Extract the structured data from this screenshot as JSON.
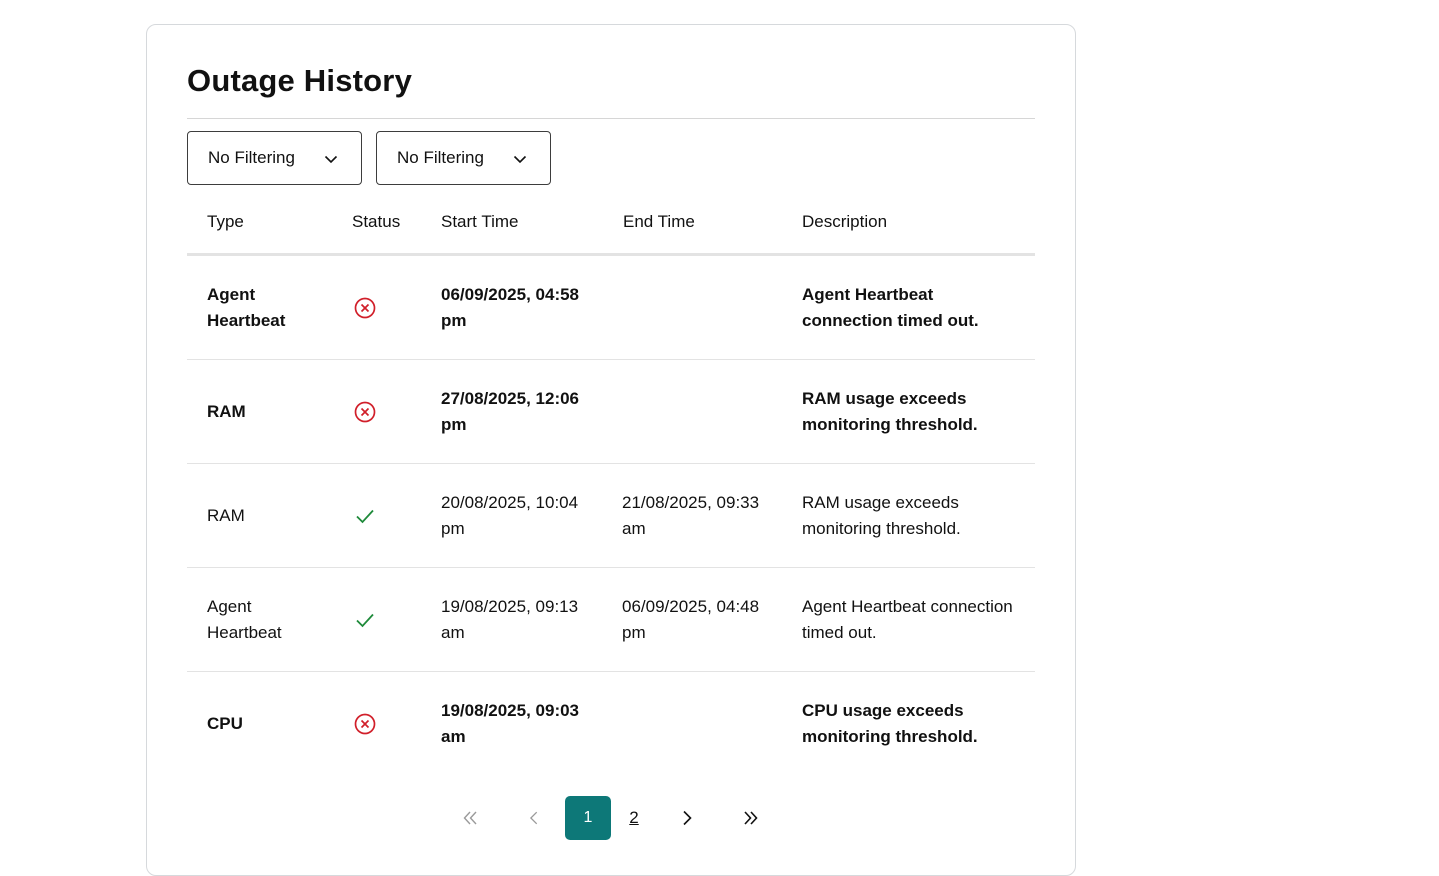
{
  "card": {
    "title": "Outage History"
  },
  "filters": [
    {
      "label": "No Filtering"
    },
    {
      "label": "No Filtering"
    }
  ],
  "table": {
    "headers": [
      "Type",
      "Status",
      "Start Time",
      "End Time",
      "Description"
    ],
    "rows": [
      {
        "type": "Agent Heartbeat",
        "status": "failed",
        "start": "06/09/2025, 04:58 pm",
        "end": "",
        "description": "Agent Heartbeat connection timed out.",
        "emphasis": true
      },
      {
        "type": "RAM",
        "status": "failed",
        "start": "27/08/2025, 12:06 pm",
        "end": "",
        "description": "RAM usage exceeds monitoring threshold.",
        "emphasis": true
      },
      {
        "type": "RAM",
        "status": "resolved",
        "start": "20/08/2025, 10:04 pm",
        "end": "21/08/2025, 09:33 am",
        "description": "RAM usage exceeds monitoring threshold.",
        "emphasis": false
      },
      {
        "type": "Agent Heartbeat",
        "status": "resolved",
        "start": "19/08/2025, 09:13 am",
        "end": "06/09/2025, 04:48 pm",
        "description": "Agent Heartbeat connection timed out.",
        "emphasis": false
      },
      {
        "type": "CPU",
        "status": "failed",
        "start": "19/08/2025, 09:03 am",
        "end": "",
        "description": "CPU usage exceeds monitoring threshold.",
        "emphasis": true
      }
    ]
  },
  "pagination": {
    "pages": [
      "1",
      "2"
    ],
    "current": "1"
  },
  "colors": {
    "accent": "#0d7878",
    "failed": "#d11f2a",
    "resolved": "#1e8a3a"
  },
  "icons": {
    "failed": "x-circle-icon",
    "resolved": "check-icon",
    "filter": "chevron-down-icon"
  }
}
